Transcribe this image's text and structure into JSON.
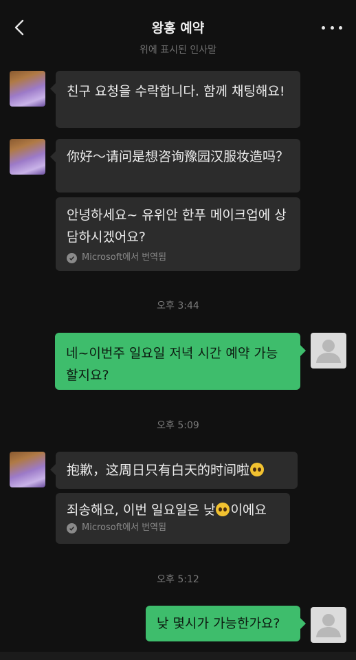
{
  "header": {
    "title": "왕홍 예약",
    "back_icon": "chevron-left-icon",
    "more_icon": "more-dots-icon"
  },
  "greeting_hint": "위에 표시된 인사말",
  "messages": [
    {
      "text": "친구 요청을 수락합니다. 함께 채팅해요!"
    },
    {
      "text": "你好～请问是想咨询豫园汉服妆造吗？"
    },
    {
      "text": "안녕하세요~ 유위안 한푸 메이크업에 상담하시겠어요?",
      "note": "Microsoft에서 번역됨"
    },
    {
      "text": "네~이번주 일요일 저녁 시간 예약 가능할지요?"
    },
    {
      "text_before": "抱歉，这周日只有白天的时间啦",
      "text_after": ""
    },
    {
      "text_before": "죄송해요, 이번 일요일은 낮",
      "text_after": "이에요",
      "note": "Microsoft에서 번역됨"
    },
    {
      "text": "낮 몇시가 가능한가요?"
    }
  ],
  "timestamps": [
    "오후 3:44",
    "오후 5:09",
    "오후 5:12"
  ],
  "colors": {
    "background": "#111111",
    "incoming_bubble": "#2c2c2c",
    "outgoing_bubble": "#3ebd6c",
    "secondary_text": "#7a7a7a"
  }
}
